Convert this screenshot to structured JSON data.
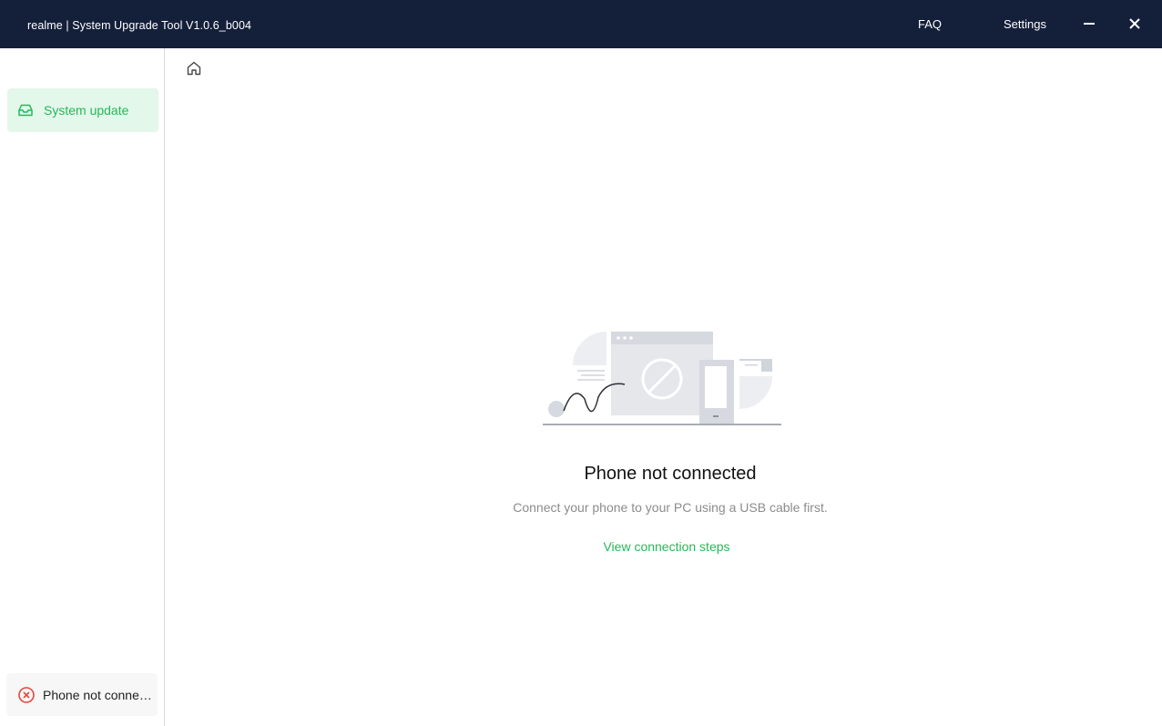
{
  "window": {
    "title": "realme | System Upgrade Tool  V1.0.6_b004",
    "menu": {
      "faq": "FAQ",
      "settings": "Settings"
    }
  },
  "sidebar": {
    "items": [
      {
        "label": "System update",
        "icon": "inbox-icon",
        "active": true
      }
    ],
    "status": {
      "label": "Phone not connected",
      "icon": "error-circle-icon"
    }
  },
  "main": {
    "empty_state": {
      "title": "Phone not connected",
      "description": "Connect your phone to your PC using a USB cable first.",
      "link": "View connection steps"
    }
  },
  "colors": {
    "titlebar": "#14203a",
    "accent": "#25b85a",
    "accent_bg": "#e3f7ea",
    "error": "#e8453c"
  }
}
